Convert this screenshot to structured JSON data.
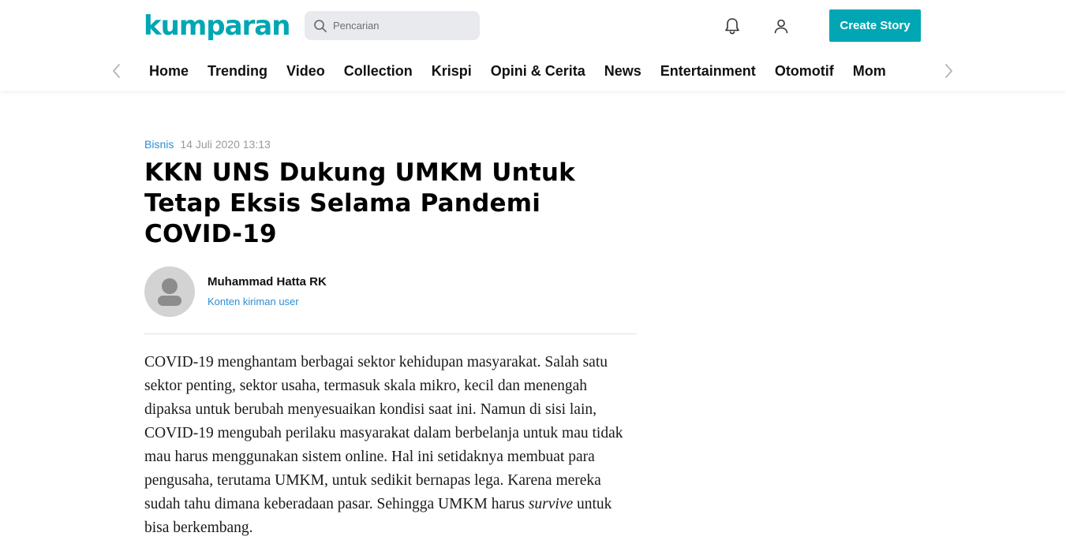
{
  "header": {
    "logo_text": "kumparan",
    "search_placeholder": "Pencarian",
    "create_story_label": "Create Story",
    "brand_color": "#00a6b3",
    "icons": [
      "search-icon",
      "bell-icon",
      "user-icon"
    ]
  },
  "nav": {
    "items": [
      "Home",
      "Trending",
      "Video",
      "Collection",
      "Krispi",
      "Opini & Cerita",
      "News",
      "Entertainment",
      "Otomotif",
      "Mom"
    ]
  },
  "article": {
    "category": "Bisnis",
    "date": "14 Juli 2020 13:13",
    "title": "KKN UNS Dukung UMKM Untuk Tetap Eksis Selama Pandemi COVID-19",
    "author_name": "Muhammad Hatta RK",
    "author_subtitle": "Konten kiriman user",
    "body_before_italic": "COVID-19 menghantam berbagai sektor kehidupan masyarakat. Salah satu sektor penting, sektor usaha, termasuk skala mikro, kecil dan menengah dipaksa untuk berubah menyesuaikan kondisi saat ini. Namun di sisi lain, COVID-19 mengubah perilaku masyarakat dalam berbelanja untuk mau tidak mau harus menggunakan sistem online. Hal ini setidaknya membuat para pengusaha, terutama UMKM, untuk sedikit bernapas lega. Karena mereka sudah tahu dimana keberadaan pasar. Sehingga UMKM harus ",
    "body_italic": "survive",
    "body_after_italic": " untuk bisa berkembang."
  }
}
